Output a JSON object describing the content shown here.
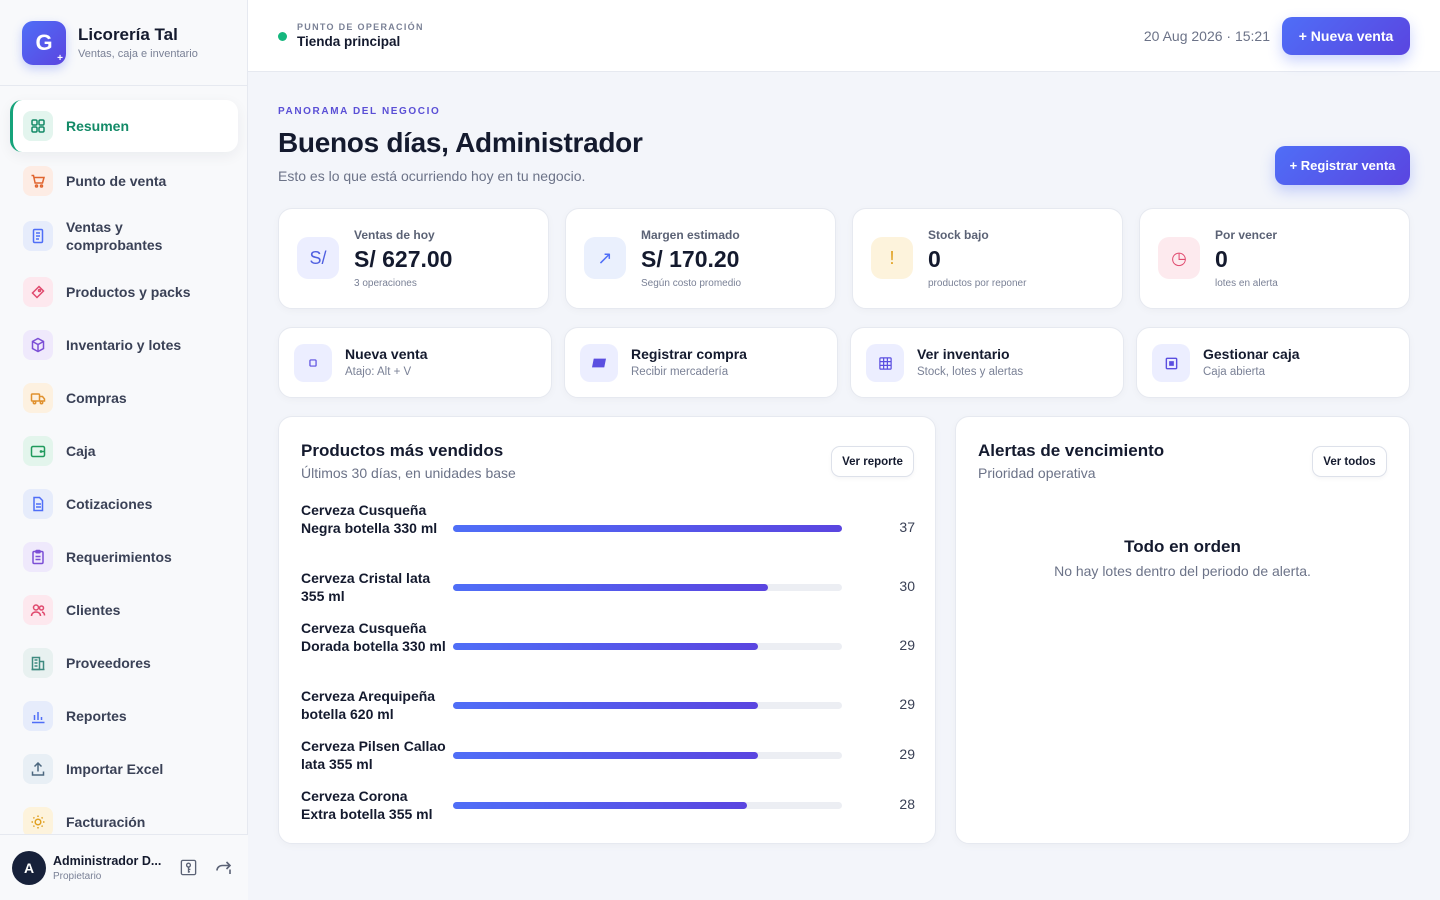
{
  "brand": {
    "initial": "G",
    "title": "Licorería Tal",
    "subtitle": "Ventas, caja e inventario"
  },
  "nav": [
    {
      "label": "Resumen",
      "active": true
    },
    {
      "label": "Punto de venta"
    },
    {
      "label": "Ventas y comprobantes"
    },
    {
      "label": "Productos y packs"
    },
    {
      "label": "Inventario y lotes"
    },
    {
      "label": "Compras"
    },
    {
      "label": "Caja"
    },
    {
      "label": "Cotizaciones"
    },
    {
      "label": "Requerimientos"
    },
    {
      "label": "Clientes"
    },
    {
      "label": "Proveedores"
    },
    {
      "label": "Reportes"
    },
    {
      "label": "Importar Excel"
    },
    {
      "label": "Facturación"
    }
  ],
  "user": {
    "initial": "A",
    "name": "Administrador D...",
    "role": "Propietario"
  },
  "topbar": {
    "kicker": "PUNTO DE OPERACIÓN",
    "location": "Tienda principal",
    "datetime": "20 Aug 2026 · 15:21",
    "new_sale": "+ Nueva venta"
  },
  "header": {
    "kicker": "PANORAMA DEL NEGOCIO",
    "greeting": "Buenos días, Administrador",
    "subtitle": "Esto es lo que está ocurriendo hoy en tu negocio.",
    "register_sale": "+ Registrar venta"
  },
  "stats": [
    {
      "icon": "S/",
      "label": "Ventas de hoy",
      "value": "S/ 627.00",
      "note": "3 operaciones"
    },
    {
      "icon": "↗",
      "label": "Margen estimado",
      "value": "S/ 170.20",
      "note": "Según costo promedio"
    },
    {
      "icon": "!",
      "label": "Stock bajo",
      "value": "0",
      "note": "productos por reponer"
    },
    {
      "icon": "◷",
      "label": "Por vencer",
      "value": "0",
      "note": "lotes en alerta"
    }
  ],
  "quick_actions": [
    {
      "title": "Nueva venta",
      "subtitle": "Atajo: Alt + V"
    },
    {
      "title": "Registrar compra",
      "subtitle": "Recibir mercadería"
    },
    {
      "title": "Ver inventario",
      "subtitle": "Stock, lotes y alertas"
    },
    {
      "title": "Gestionar caja",
      "subtitle": "Caja abierta"
    }
  ],
  "top_products": {
    "title": "Productos más vendidos",
    "subtitle": "Últimos 30 días, en unidades base",
    "button": "Ver reporte",
    "items": [
      {
        "name": "Cerveza Cusqueña Negra botella 330 ml",
        "value": 37
      },
      {
        "name": "Cerveza Cristal lata 355 ml",
        "value": 30
      },
      {
        "name": "Cerveza Cusqueña Dorada botella 330 ml",
        "value": 29
      },
      {
        "name": "Cerveza Arequipeña botella 620 ml",
        "value": 29
      },
      {
        "name": "Cerveza Pilsen Callao lata 355 ml",
        "value": 29
      },
      {
        "name": "Cerveza Corona Extra botella 355 ml",
        "value": 28
      }
    ]
  },
  "expiry_alerts": {
    "title": "Alertas de vencimiento",
    "subtitle": "Prioridad operativa",
    "button": "Ver todos",
    "empty_title": "Todo en orden",
    "empty_text": "No hay lotes dentro del periodo de alerta."
  },
  "colors": {
    "accent": "#4f6ef7",
    "accent_dark": "#5a45e0",
    "active_nav": "#15a37a",
    "status_online": "#15b77e"
  }
}
